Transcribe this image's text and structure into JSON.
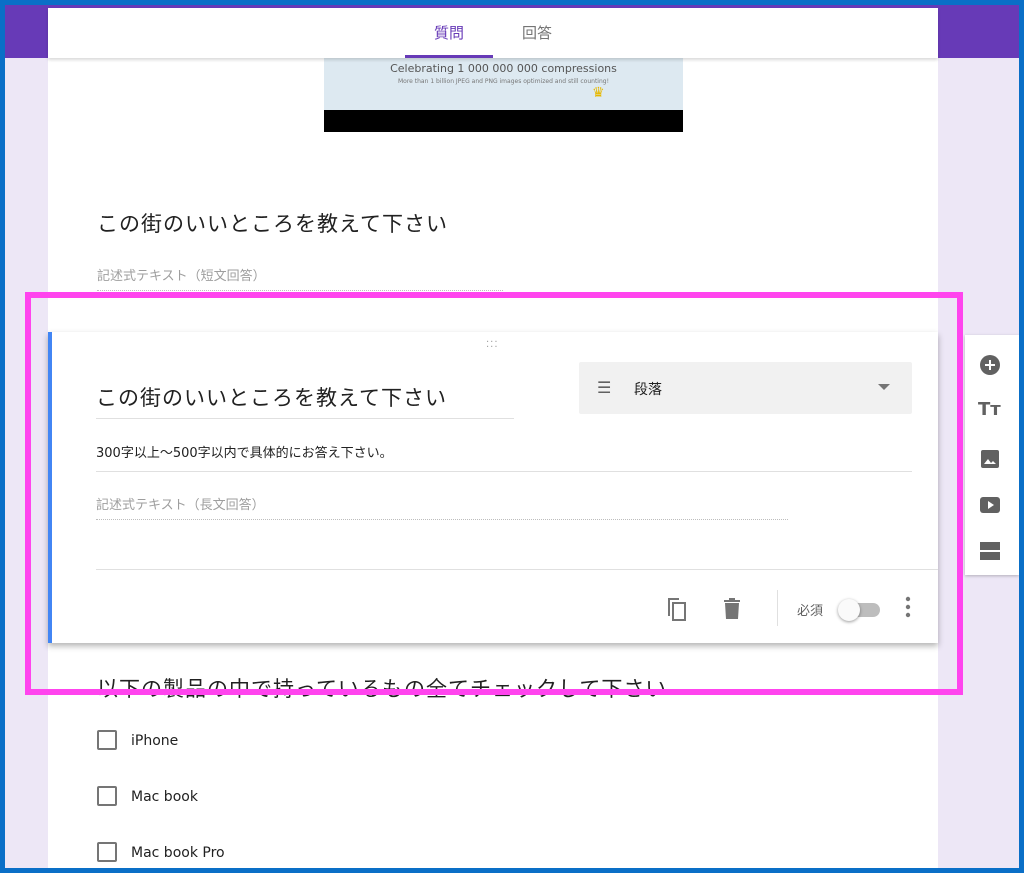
{
  "tabs": [
    {
      "label": "質問",
      "active": true
    },
    {
      "label": "回答",
      "active": false
    }
  ],
  "banner": {
    "headline": "Celebrating 1 000 000 000 compressions",
    "sub": "More than 1 billion JPEG and PNG images optimized and still counting!"
  },
  "question1": {
    "title": "この街のいいところを教えて下さい",
    "placeholder": "記述式テキスト（短文回答）"
  },
  "active_question": {
    "title": "この街のいいところを教えて下さい",
    "type": "段落",
    "description": "300字以上〜500字以内で具体的にお答え下さい。",
    "placeholder": "記述式テキスト（長文回答）",
    "required_label": "必須",
    "required": false
  },
  "question3": {
    "title": "以下の製品の中で持っているもの全てチェックして下さい",
    "options": [
      "iPhone",
      "Mac book",
      "Mac book Pro"
    ]
  },
  "side_toolbar": [
    "add-question-icon",
    "add-title-icon",
    "add-image-icon",
    "add-video-icon",
    "add-section-icon"
  ],
  "colors": {
    "accent": "#673ab7",
    "highlight": "#ff44ee",
    "frame": "#0a6fc7",
    "active_bar": "#4285f4"
  }
}
